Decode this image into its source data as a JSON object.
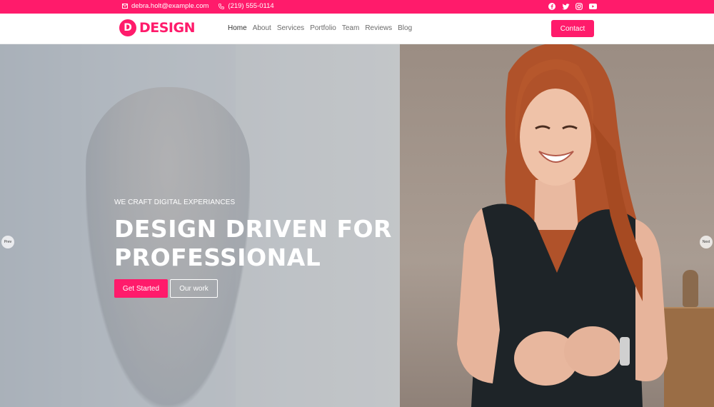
{
  "topbar": {
    "email": "debra.holt@example.com",
    "phone": "(219) 555-0114",
    "socials": [
      "facebook-icon",
      "twitter-icon",
      "instagram-icon",
      "youtube-icon"
    ]
  },
  "nav": {
    "logo_mark": "D",
    "logo_text": "DESIGN",
    "items": [
      "Home",
      "About",
      "Services",
      "Portfolio",
      "Team",
      "Reviews",
      "Blog"
    ],
    "active": "Home",
    "contact_label": "Contact"
  },
  "hero": {
    "eyebrow": "WE CRAFT DIGITAL EXPERIANCES",
    "headline_line1": "DESIGN DRIVEN FOR",
    "headline_line2": "PROFESSIONAL",
    "primary_button": "Get Started",
    "secondary_button": "Our work",
    "prev_label": "Prev",
    "next_label": "Next"
  },
  "colors": {
    "accent": "#ff1b6b"
  }
}
